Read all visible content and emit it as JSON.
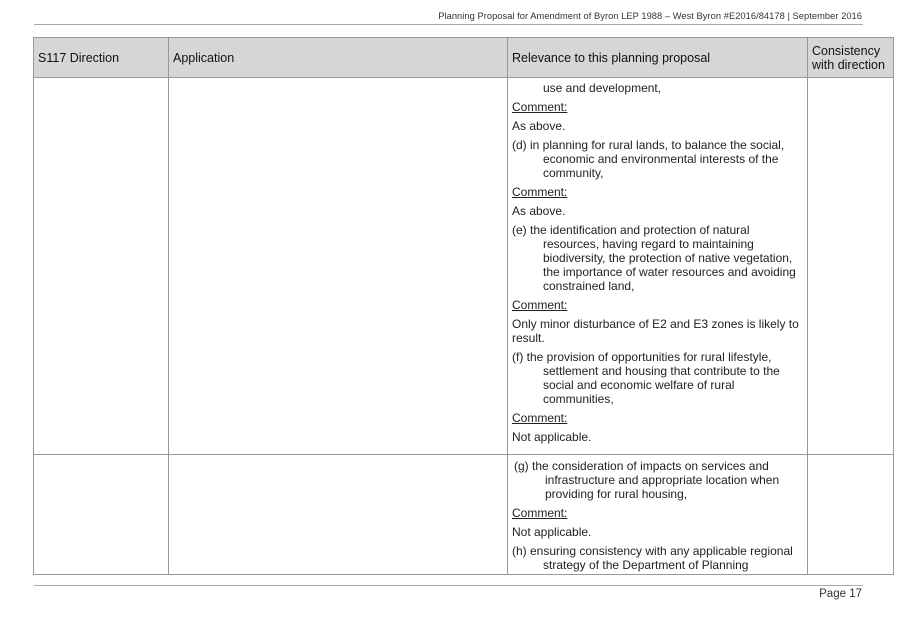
{
  "header": {
    "running_title": "Planning Proposal for Amendment of Byron LEP 1988 – West Byron #E2016/84178 | September  2016"
  },
  "table": {
    "columns": [
      "S117 Direction",
      "Application",
      "Relevance to this planning proposal",
      "Consistency with direction"
    ],
    "rows": [
      {
        "relevance": [
          {
            "kind": "hang",
            "text": "use and development,"
          },
          {
            "kind": "comment",
            "text": "Comment:"
          },
          {
            "kind": "plain",
            "text": "As above."
          },
          {
            "kind": "item",
            "text": "(d)  in planning for rural lands, to balance the social, economic and environmental interests of the community,"
          },
          {
            "kind": "comment",
            "text": "Comment:"
          },
          {
            "kind": "plain",
            "text": "As above."
          },
          {
            "kind": "item",
            "text": "(e)  the identification and protection of natural resources, having regard to maintaining biodiversity, the protection of native vegetation, the importance of water resources and avoiding constrained land,"
          },
          {
            "kind": "comment",
            "text": "Comment:"
          },
          {
            "kind": "plain",
            "text": "Only minor disturbance of E2 and E3 zones is likely to result."
          },
          {
            "kind": "item",
            "text": "(f)  the provision of opportunities for rural lifestyle, settlement and housing that contribute to the social and economic welfare of rural communities,"
          },
          {
            "kind": "comment",
            "text": "Comment:"
          },
          {
            "kind": "plain",
            "text": "Not applicable."
          }
        ]
      },
      {
        "relevance": [
          {
            "kind": "item",
            "text": "(g)  the consideration of impacts on services and infrastructure and appropriate location when providing for rural housing,"
          },
          {
            "kind": "comment",
            "text": "Comment:"
          },
          {
            "kind": "plain",
            "text": "Not applicable."
          },
          {
            "kind": "item",
            "text": "(h)  ensuring consistency with any applicable regional strategy of the Department of Planning"
          }
        ]
      }
    ]
  },
  "footer": {
    "page_label": "Page 17"
  }
}
